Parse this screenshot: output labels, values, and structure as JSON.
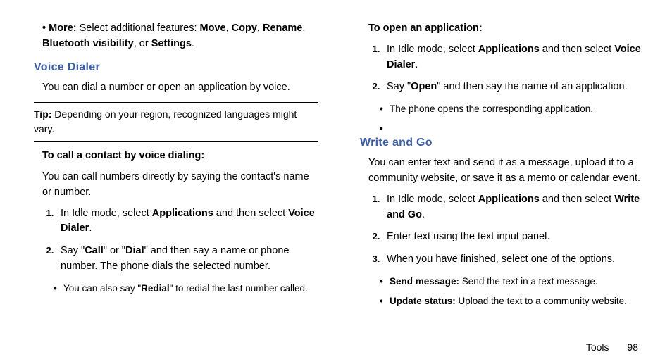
{
  "left": {
    "more_prefix": "More:",
    "more_text": " Select additional features: ",
    "more_opt1": "Move",
    "more_sep1": ", ",
    "more_opt2": "Copy",
    "more_sep2": ", ",
    "more_opt3": "Rename",
    "more_sep3": ", ",
    "more_opt4": "Bluetooth visibility",
    "more_sep4": ", or ",
    "more_opt5": "Settings",
    "more_end": ".",
    "heading1": "Voice Dialer",
    "vd_intro": "You can dial a number or open an application by voice.",
    "tip_label": "Tip:",
    "tip_text": " Depending on your region, recognized languages might vary.",
    "call_subhead": "To call a contact by voice dialing:",
    "call_intro": "You can call numbers directly by saying the contact's name or number.",
    "step1_a": "In Idle mode, select ",
    "step1_b": "Applications",
    "step1_c": " and then select ",
    "step1_d": "Voice Dialer",
    "step1_e": ".",
    "step2_a": "Say \"",
    "step2_b": "Call",
    "step2_c": "\" or \"",
    "step2_d": "Dial",
    "step2_e": "\" and then say a name or phone number. The phone dials the selected number.",
    "sub2_a": "You can also say \"",
    "sub2_b": "Redial",
    "sub2_c": "\" to redial the last number called."
  },
  "right": {
    "open_subhead": "To open an application:",
    "o_step1_a": "In Idle mode, select ",
    "o_step1_b": "Applications",
    "o_step1_c": " and then select ",
    "o_step1_d": "Voice Dialer",
    "o_step1_e": ".",
    "o_step2_a": "Say \"",
    "o_step2_b": "Open",
    "o_step2_c": "\" and then say the name of an application.",
    "o_sub": "The phone opens the corresponding application.",
    "heading2": "Write and Go",
    "wg_intro": "You can enter text and send it as a message, upload it to a community website, or save it as a memo or calendar event.",
    "w_step1_a": "In Idle mode, select ",
    "w_step1_b": "Applications",
    "w_step1_c": " and then select ",
    "w_step1_d": "Write and Go",
    "w_step1_e": ".",
    "w_step2": "Enter text using the text input panel.",
    "w_step3": "When you have finished, select one of the options.",
    "w_sub1_b": "Send message:",
    "w_sub1_t": " Send the text in a text message.",
    "w_sub2_b": "Update status:",
    "w_sub2_t": " Upload the text to a community website."
  },
  "footer": {
    "section": "Tools",
    "page": "98"
  }
}
